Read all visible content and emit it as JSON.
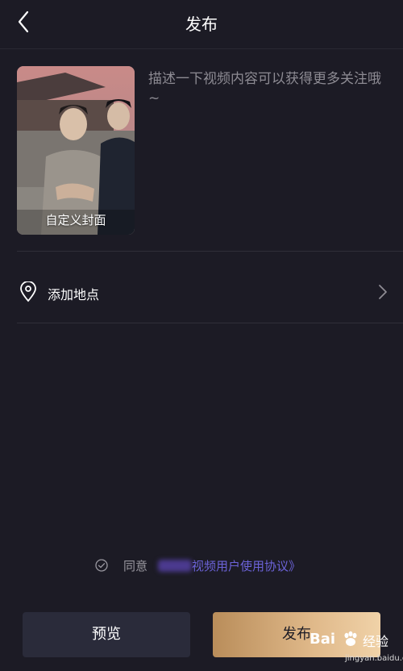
{
  "header": {
    "title": "发布"
  },
  "cover": {
    "label": "自定义封面"
  },
  "description": {
    "placeholder": "描述一下视频内容可以获得更多关注哦~"
  },
  "location": {
    "label": "添加地点"
  },
  "agreement": {
    "prefix": "同意",
    "link": "视频用户使用协议》"
  },
  "actions": {
    "preview_label": "预览",
    "publish_label": "发布"
  },
  "watermark": {
    "logo": "Bai",
    "text": "经验",
    "url": "jingyan.baidu.com"
  },
  "colors": {
    "background": "#1c1b25",
    "accent_link": "#6c63d9",
    "publish_gradient_start": "#b98d5a",
    "publish_gradient_end": "#f0d2a8"
  }
}
